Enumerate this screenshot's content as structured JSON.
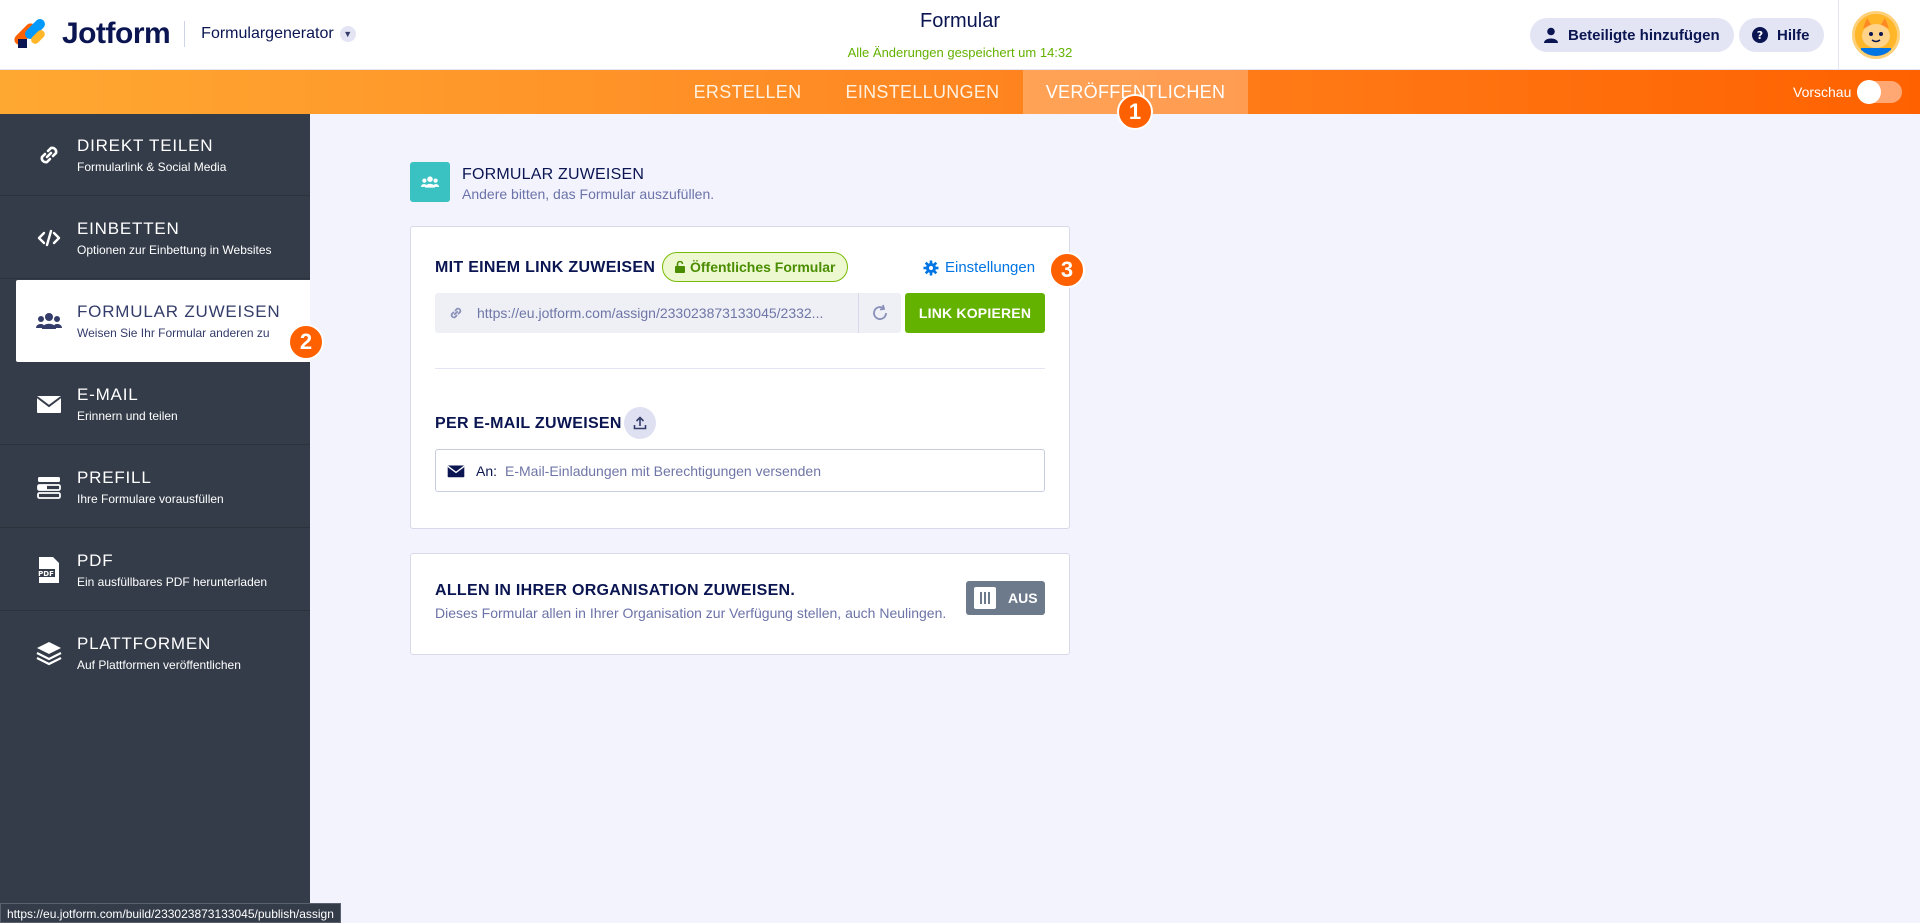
{
  "header": {
    "logo_text": "Jotform",
    "builder_label": "Formulargenerator",
    "form_title": "Formular",
    "saved_status": "Alle Änderungen gespeichert um 14:32",
    "participants_button": "Beteiligte hinzufügen",
    "help_button": "Hilfe"
  },
  "nav": {
    "tabs": [
      {
        "label": "ERSTELLEN"
      },
      {
        "label": "EINSTELLUNGEN"
      },
      {
        "label": "VERÖFFENTLICHEN"
      }
    ],
    "preview_label": "Vorschau",
    "preview_on": false
  },
  "steps": [
    "1",
    "2",
    "3"
  ],
  "sidebar": {
    "items": [
      {
        "title": "DIREKT TEILEN",
        "subtitle": "Formularlink & Social Media",
        "icon": "link-icon"
      },
      {
        "title": "EINBETTEN",
        "subtitle": "Optionen zur Einbettung in Websites",
        "icon": "code-icon"
      },
      {
        "title": "FORMULAR ZUWEISEN",
        "subtitle": "Weisen Sie Ihr Formular anderen zu",
        "icon": "users-icon"
      },
      {
        "title": "E-MAIL",
        "subtitle": "Erinnern und teilen",
        "icon": "envelope-icon"
      },
      {
        "title": "PREFILL",
        "subtitle": "Ihre Formulare vorausfüllen",
        "icon": "prefill-icon"
      },
      {
        "title": "PDF",
        "subtitle": "Ein ausfüllbares PDF herunterladen",
        "icon": "pdf-icon"
      },
      {
        "title": "PLATTFORMEN",
        "subtitle": "Auf Plattformen veröffentlichen",
        "icon": "layers-icon"
      }
    ]
  },
  "main": {
    "section_title": "FORMULAR ZUWEISEN",
    "section_subtitle": "Andere bitten, das Formular auszufüllen.",
    "link_assign_label": "MIT EINEM LINK ZUWEISEN",
    "public_badge": "Öffentliches Formular",
    "settings_link": "Einstellungen",
    "assign_url": "https://eu.jotform.com/assign/233023873133045/2332...",
    "copy_button": "LINK KOPIEREN",
    "email_assign_label": "PER E-MAIL ZUWEISEN",
    "email_to_label": "An:",
    "email_placeholder": "E-Mail-Einladungen mit Berechtigungen versenden",
    "org_title": "ALLEN IN IHRER ORGANISATION ZUWEISEN.",
    "org_subtitle": "Dieses Formular allen in Ihrer Organisation zur Verfügung stellen, auch Neulingen.",
    "org_toggle": "AUS"
  },
  "status_bar_url": "https://eu.jotform.com/build/233023873133045/publish/assign",
  "colors": {
    "brand_orange": "#ff6100",
    "sidebar_bg": "#343c49",
    "accent_green": "#64b200",
    "link_blue": "#0075e3",
    "teal": "#3ac2c3"
  }
}
